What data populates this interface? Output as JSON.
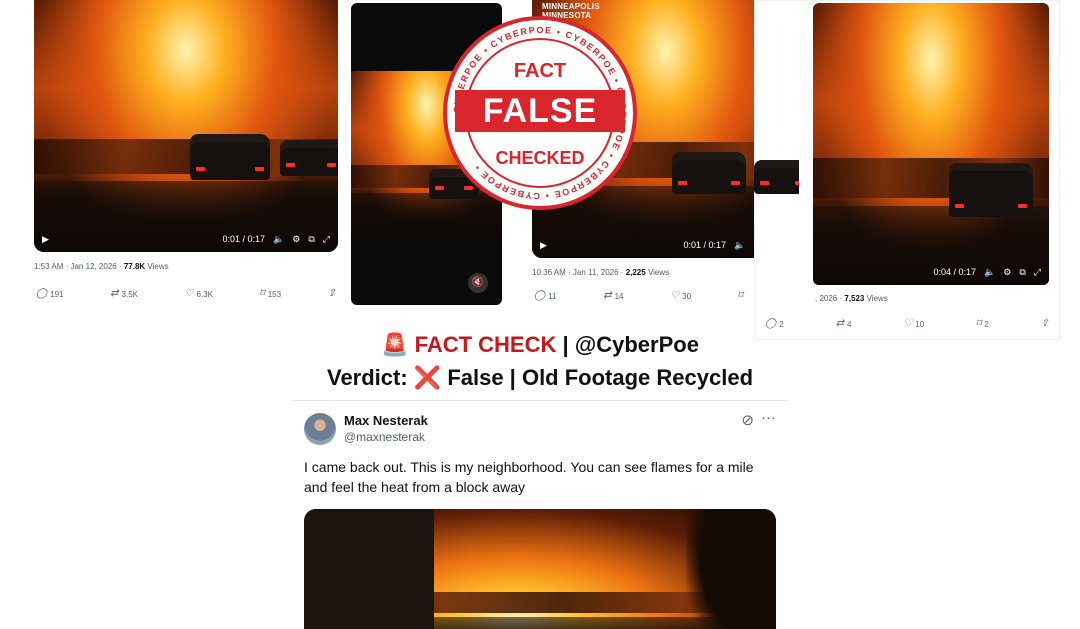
{
  "posts": [
    {
      "video": {
        "time": "0:01 / 0:17"
      },
      "meta": {
        "datetime": "1:53 AM · Jan 12, 2026 · ",
        "views": "77.8K",
        "views_label": " Views"
      },
      "actions": {
        "replies": "191",
        "reposts": "3.5K",
        "likes": "6.3K",
        "bookmarks": "153"
      }
    },
    {
      "watermark": [
        "MINNEAPOLIS",
        "MINNESOTA"
      ],
      "video": {
        "time": "0:01 / 0:17"
      },
      "meta": {
        "datetime": "10:36 AM · Jan 11, 2026 · ",
        "views": "2,225",
        "views_label": " Views"
      },
      "actions": {
        "replies": "11",
        "reposts": "14",
        "likes": "30"
      }
    },
    {
      "video": {
        "time": "0:04 / 0:17"
      },
      "meta": {
        "datetime": ", 2026 · ",
        "views": "7,523",
        "views_label": " Views"
      },
      "actions": {
        "replies": "2",
        "reposts": "4",
        "likes": "10",
        "bookmarks": "2"
      }
    }
  ],
  "stamp": {
    "top_word": "FACT",
    "band_word": "FALSE",
    "bottom_word": "CHECKED",
    "ring_text": "CYBERPOE",
    "color": "#d9252b"
  },
  "headline": {
    "emoji": "🚨",
    "fact_check": "FACT CHECK",
    "separator": " | ",
    "handle": "@CyberPoe",
    "verdict_label": "Verdict: ",
    "verdict_icon": "❌",
    "verdict": " False | Old Footage Recycled",
    "accent": "#c8161d"
  },
  "tweet": {
    "name": "Max Nesterak",
    "handle": "@maxnesterak",
    "text": "I came back out. This is my neighborhood. You can see flames for a mile and feel the heat from a block away"
  },
  "icons": {
    "play": "play-icon",
    "volume": "volume-icon",
    "settings": "gear-icon",
    "pip": "pip-icon",
    "fullscreen": "fullscreen-icon",
    "reply": "reply-icon",
    "repost": "repost-icon",
    "like": "heart-icon",
    "bookmark": "bookmark-icon",
    "share": "share-icon",
    "mute": "mute-icon",
    "grok": "grok-icon",
    "more": "more-icon"
  }
}
